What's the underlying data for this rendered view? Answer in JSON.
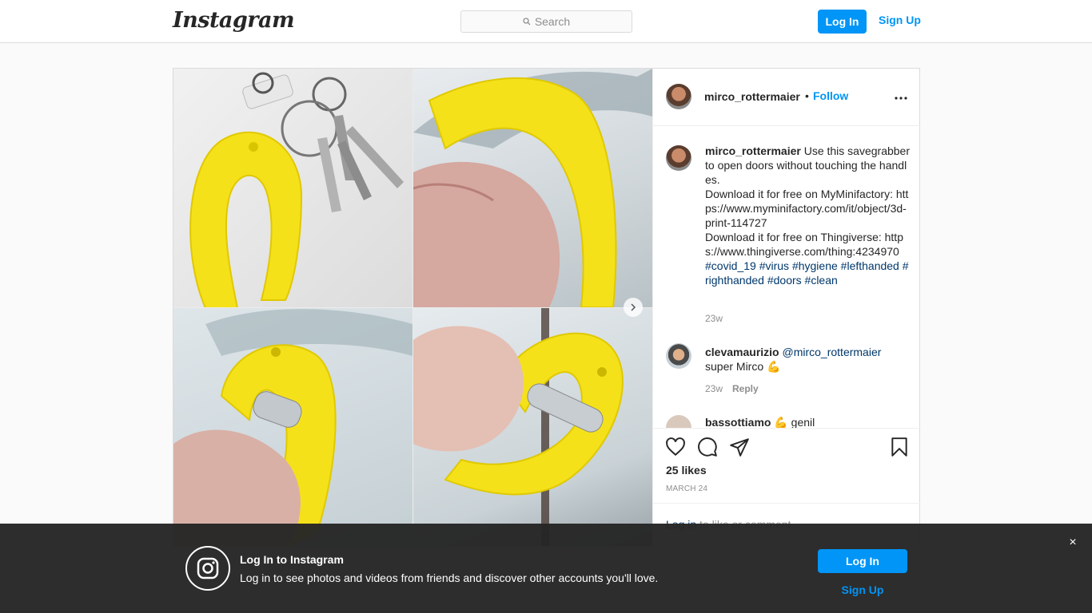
{
  "nav": {
    "logo": "Instagram",
    "search_placeholder": "Search",
    "login_label": "Log In",
    "signup_label": "Sign Up"
  },
  "post": {
    "username": "mirco_rottermaier",
    "dot": "•",
    "follow_label": "Follow",
    "more_icon": "more-horizontal-icon",
    "caption": {
      "username": "mirco_rottermaier",
      "line1": "Use this savegrabber to open doors without touching the handles.",
      "line2": "Download it for free on MyMinifactory: https://www.myminifactory.com/it/object/3d-print-114727",
      "line3": "Download it for free on Thingiverse: https://www.thingiverse.com/thing:4234970",
      "hashtags": "#covid_19 #virus #hygiene #lefthanded #righthanded #doors #clean",
      "time": "23w"
    },
    "comments": [
      {
        "username": "clevamaurizio",
        "mention": "@mirco_rottermaier",
        "text": "super Mirco 💪",
        "time": "23w",
        "reply_label": "Reply"
      },
      {
        "username": "bassottiamo",
        "text": "💪 genil"
      }
    ],
    "likes": "25 likes",
    "date": "MARCH 24",
    "login_link": "Log in",
    "login_suffix": " to like or comment."
  },
  "banner": {
    "title": "Log In to Instagram",
    "text": "Log in to see photos and videos from friends and discover other accounts you'll love.",
    "login_label": "Log In",
    "signup_label": "Sign Up",
    "close_symbol": "×"
  },
  "colors": {
    "accent": "#0095f6",
    "link_dark": "#00376b",
    "grabber_yellow": "#f5e11a",
    "banner_bg": "#262626"
  }
}
